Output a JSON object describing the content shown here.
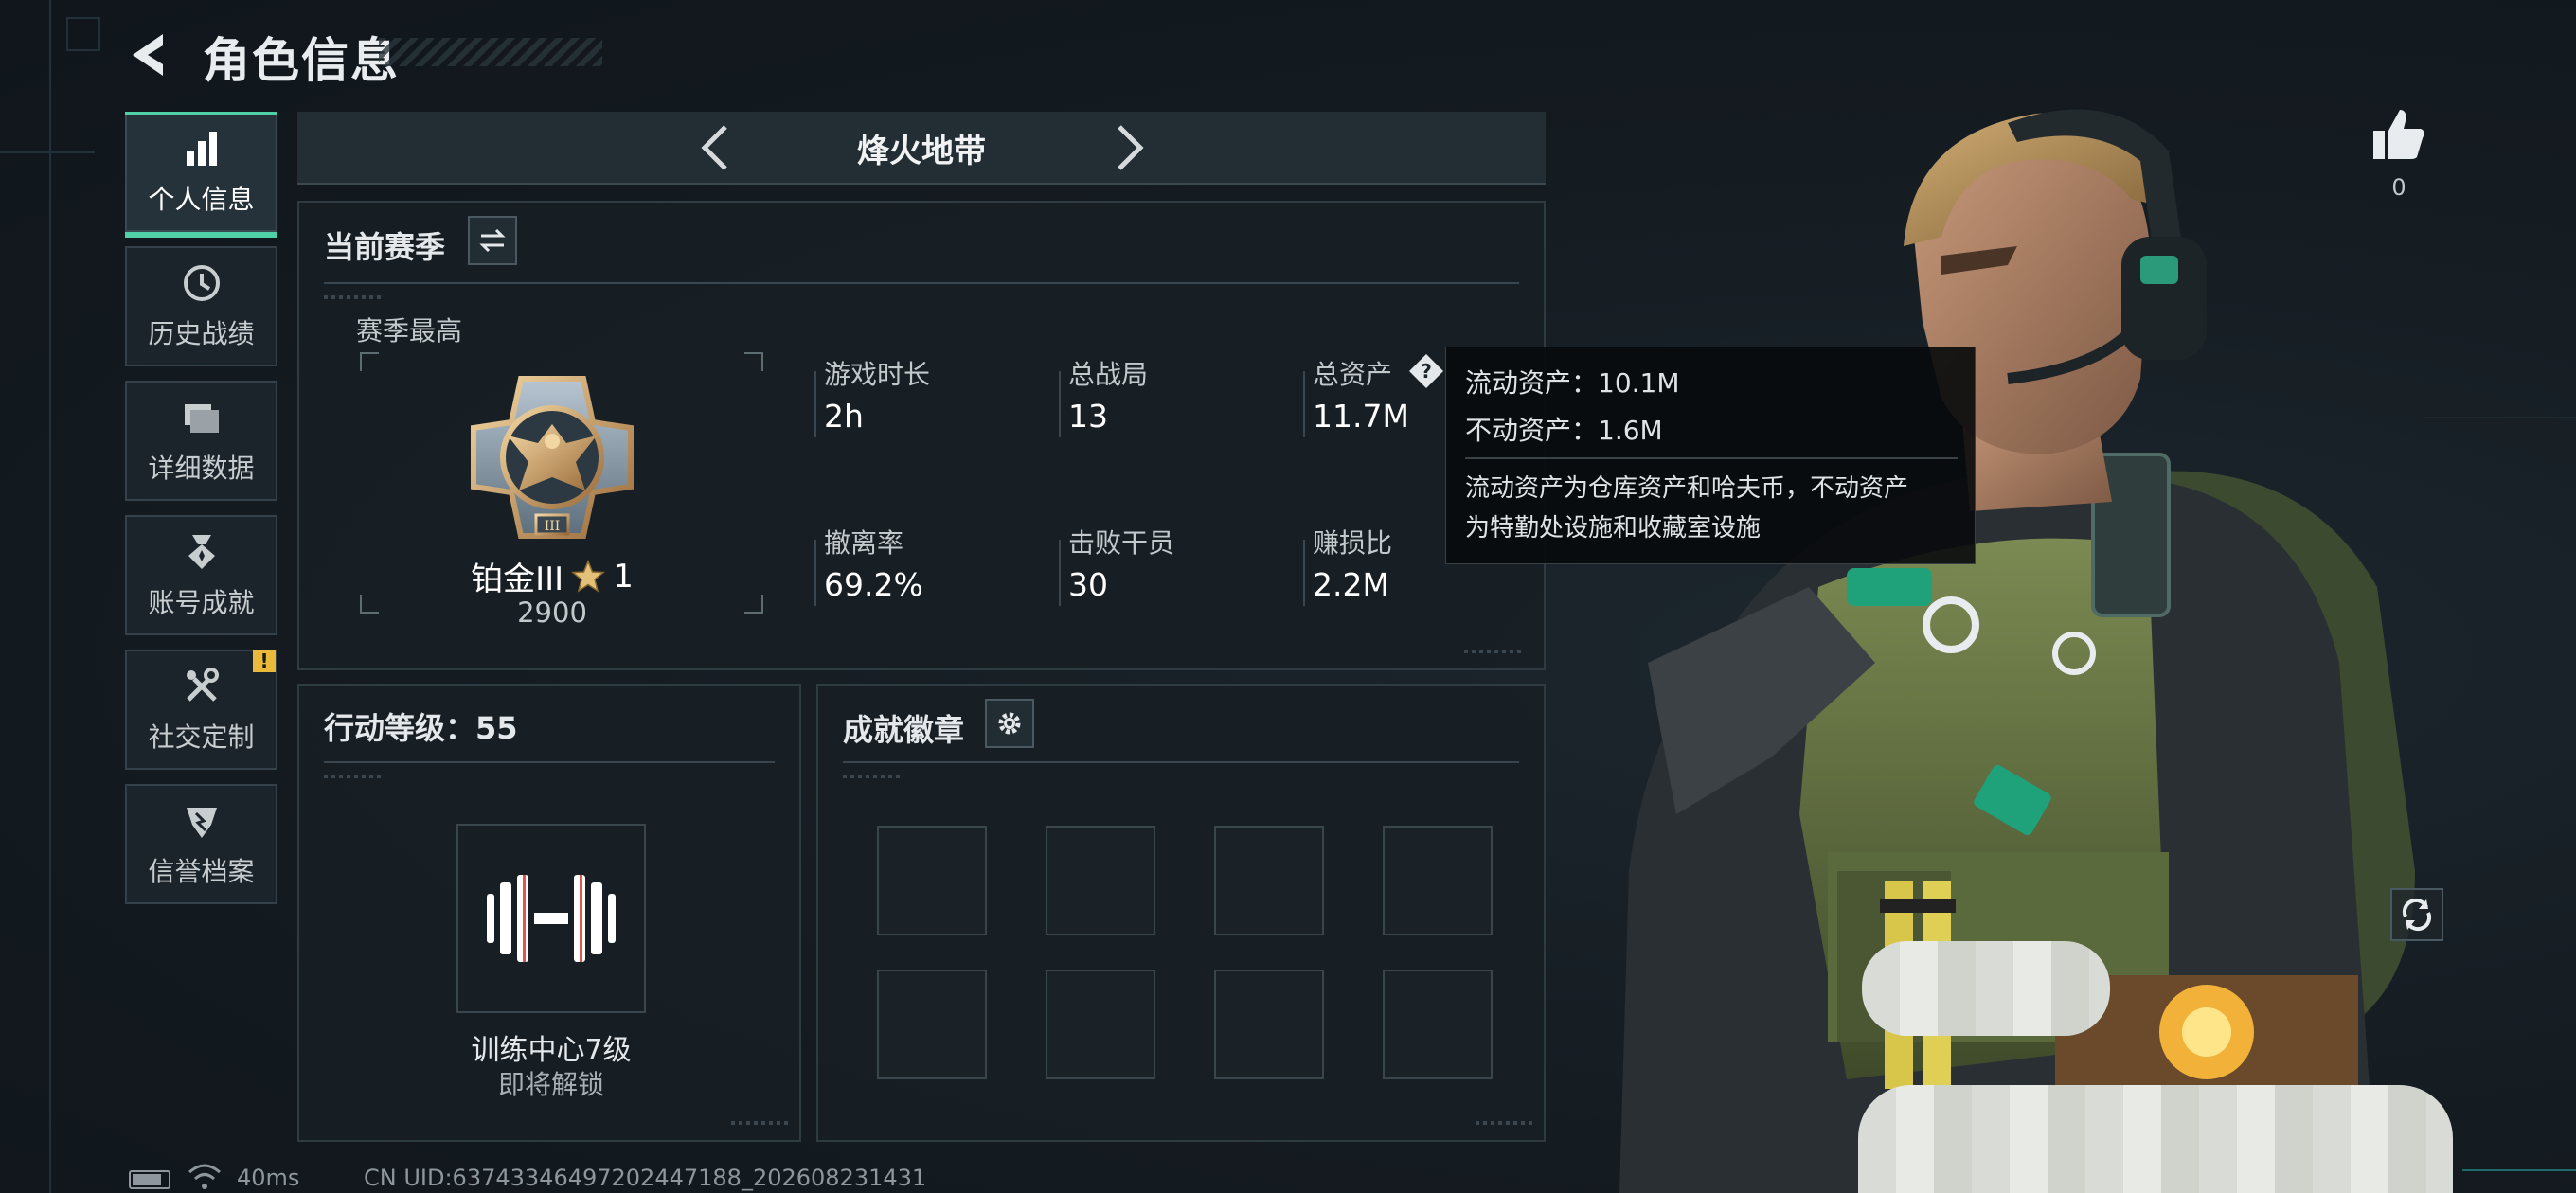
{
  "header": {
    "title": "角色信息"
  },
  "nav": {
    "items": [
      {
        "label": "个人信息",
        "icon": "bar-chart-icon",
        "active": true
      },
      {
        "label": "历史战绩",
        "icon": "clock-icon",
        "active": false
      },
      {
        "label": "详细数据",
        "icon": "folder-icon",
        "active": false
      },
      {
        "label": "账号成就",
        "icon": "medal-icon",
        "active": false
      },
      {
        "label": "社交定制",
        "icon": "tools-icon",
        "active": false,
        "alert": "!"
      },
      {
        "label": "信誉档案",
        "icon": "shield-icon",
        "active": false
      }
    ]
  },
  "mode": {
    "title": "烽火地带"
  },
  "season": {
    "title": "当前赛季",
    "best_label": "赛季最高",
    "rank_name": "铂金III",
    "rank_stars": "1",
    "rank_score": "2900",
    "stats": [
      {
        "label": "游戏时长",
        "value": "2h"
      },
      {
        "label": "总战局",
        "value": "13"
      },
      {
        "label": "总资产",
        "value": "11.7M"
      },
      {
        "label": "撤离率",
        "value": "69.2%"
      },
      {
        "label": "击败干员",
        "value": "30"
      },
      {
        "label": "赚损比",
        "value": "2.2M"
      }
    ]
  },
  "tooltip": {
    "liquid": "流动资产：10.1M",
    "fixed": "不动资产：1.6M",
    "desc_line1": "流动资产为仓库资产和哈夫币，不动资产",
    "desc_line2": "为特勤处设施和收藏室设施"
  },
  "action_level": {
    "title": "行动等级：55",
    "unlock_name": "训练中心7级",
    "unlock_status": "即将解锁"
  },
  "badges": {
    "title": "成就徽章",
    "slot_count": 8
  },
  "likes": {
    "count": "0"
  },
  "status_bar": {
    "ping": "40ms",
    "uid": "CN UID:6374334649720244718​8_202608231431"
  },
  "colors": {
    "accent": "#4fd0a6",
    "alert": "#e8b93a",
    "background": "#151c22"
  }
}
